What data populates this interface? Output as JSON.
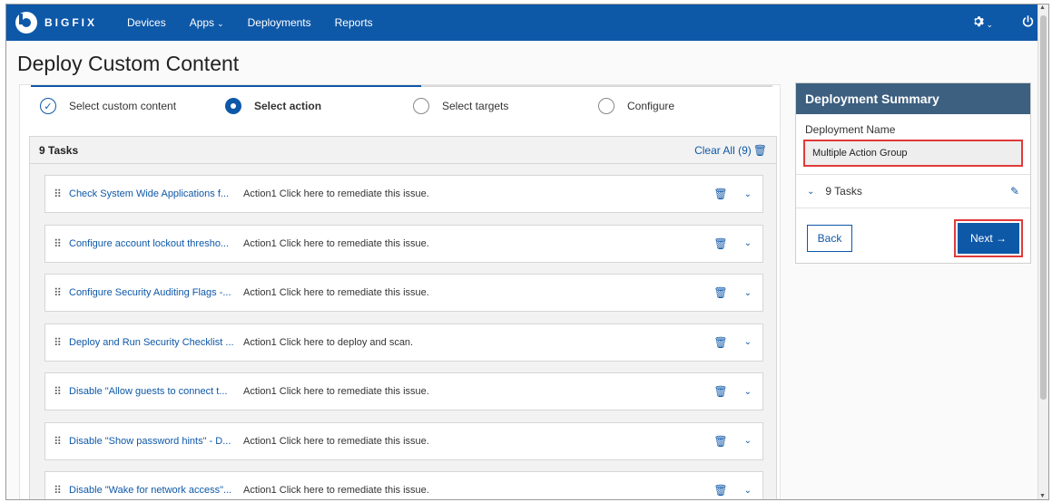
{
  "nav": {
    "logo_text": "BIGFIX",
    "items": [
      {
        "label": "Devices"
      },
      {
        "label": "Apps",
        "chevron": "⌄"
      },
      {
        "label": "Deployments"
      },
      {
        "label": "Reports"
      }
    ],
    "settings_icon": "gear-icon",
    "power_icon": "power-icon"
  },
  "page": {
    "title": "Deploy Custom Content"
  },
  "stepper": {
    "steps": [
      {
        "label": "Select custom content",
        "state": "done"
      },
      {
        "label": "Select action",
        "state": "current"
      },
      {
        "label": "Select targets",
        "state": "pending"
      },
      {
        "label": "Configure",
        "state": "pending"
      }
    ]
  },
  "tasks": {
    "count_label": "9 Tasks",
    "clear_all_label": "Clear All (9)",
    "rows": [
      {
        "name": "Check System Wide Applications f...",
        "action": "Action1 Click here to remediate this issue."
      },
      {
        "name": "Configure account lockout thresho...",
        "action": "Action1 Click here to remediate this issue."
      },
      {
        "name": "Configure Security Auditing Flags -...",
        "action": "Action1 Click here to remediate this issue."
      },
      {
        "name": "Deploy and Run Security Checklist ...",
        "action": "Action1 Click here to deploy and scan."
      },
      {
        "name": "Disable \"Allow guests to connect t...",
        "action": "Action1 Click here to remediate this issue."
      },
      {
        "name": "Disable \"Show password hints\" - D...",
        "action": "Action1 Click here to remediate this issue."
      },
      {
        "name": "Disable \"Wake for network access\"...",
        "action": "Action1 Click here to remediate this issue."
      }
    ]
  },
  "summary": {
    "title": "Deployment Summary",
    "name_label": "Deployment Name",
    "name_value": "Multiple Action Group",
    "tasks_label": "9 Tasks",
    "back_label": "Back",
    "next_label": "Next →"
  },
  "colors": {
    "brand": "#0e58a8",
    "summary_header": "#3d5f80",
    "highlight": "#e03a3a"
  }
}
